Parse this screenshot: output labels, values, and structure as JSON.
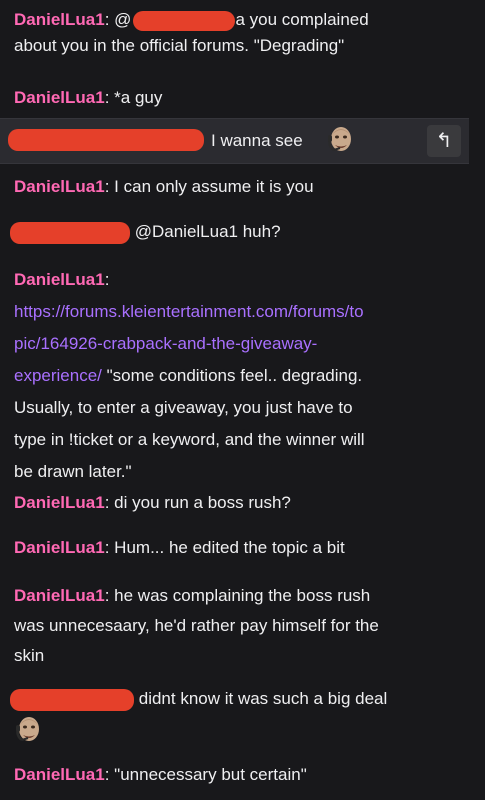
{
  "chat": {
    "m1": {
      "user": "DanielLua1",
      "colon": ":",
      "at": "@",
      "text1": "a you complained",
      "text2": "about you in the official forums. \"Degrading\""
    },
    "m2": {
      "user": "DanielLua1",
      "colon": ":",
      "text": "*a guy"
    },
    "m3": {
      "text": "I wanna see",
      "emote": "bald-man-headset-emote",
      "reply_icon": "reply-arrow-icon",
      "reply_glyph": "↰"
    },
    "m4": {
      "user": "DanielLua1",
      "colon": ":",
      "text": "I can only assume it is you"
    },
    "m5": {
      "text": "@DanielLua1 huh?"
    },
    "m6": {
      "user": "DanielLua1",
      "colon": ":",
      "link1": "https://forums.kleientertainment.com/forums/to",
      "link2": "pic/164926-crabpack-and-the-giveaway-",
      "link3": "experience/",
      "text1": " \"some conditions feel.. degrading.",
      "text2": "Usually, to enter a giveaway, you just have to",
      "text3": "type in !ticket or a keyword, and the winner will",
      "text4": "be drawn later.\""
    },
    "m7": {
      "user": "DanielLua1",
      "colon": ":",
      "text": "di you run a boss rush?"
    },
    "m8": {
      "user": "DanielLua1",
      "colon": ":",
      "text": "Hum... he edited the topic a bit"
    },
    "m9": {
      "user": "DanielLua1",
      "colon": ":",
      "text1": "he was complaining the boss rush",
      "text2": "was unnecesaary, he'd rather pay himself for the",
      "text3": "skin"
    },
    "m10": {
      "text": "didnt know it was such a big deal",
      "emote": "bald-man-headset-emote"
    },
    "m11": {
      "user": "DanielLua1",
      "colon": ":",
      "text": "\"unnecessary but certain\""
    }
  },
  "colors": {
    "background": "#18181b",
    "username": "#ff69b4",
    "link": "#a970ff",
    "redaction": "#e5402a",
    "highlight": "#2b2b30"
  }
}
